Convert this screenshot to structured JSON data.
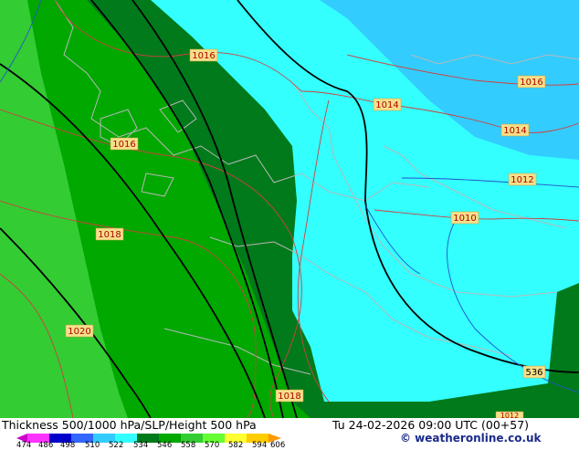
{
  "title": "Thickness 500/1000 hPa/SLP/Height 500 hPa",
  "valid_time": "Tu 24-02-2026 09:00 UTC (00+57)",
  "credit": "© weatheronline.co.uk",
  "isobar_labels": [
    "1016",
    "1016",
    "1014",
    "1016",
    "1014",
    "1012",
    "1010",
    "1018",
    "1020",
    "1018",
    "1012"
  ],
  "height_labels": [
    "536"
  ],
  "colors": {
    "band_green_light": "#33cc33",
    "band_green_mid": "#00a800",
    "band_green_dark": "#007a1a",
    "band_cyan": "#33ffff",
    "band_sky": "#33ccff",
    "label_bg": "#f5e08a",
    "isobar_line": "#d04040",
    "coast_line": "#b0b0b0"
  },
  "legend": {
    "values": [
      "474",
      "486",
      "498",
      "510",
      "522",
      "534",
      "546",
      "558",
      "570",
      "582",
      "594",
      "606"
    ],
    "colors": [
      "#cc00cc",
      "#ff33ff",
      "#0000cc",
      "#3366ff",
      "#33ccff",
      "#33ffff",
      "#007a1a",
      "#00a800",
      "#33cc33",
      "#66ff33",
      "#ffff33",
      "#ffcc00",
      "#ff9900"
    ]
  }
}
